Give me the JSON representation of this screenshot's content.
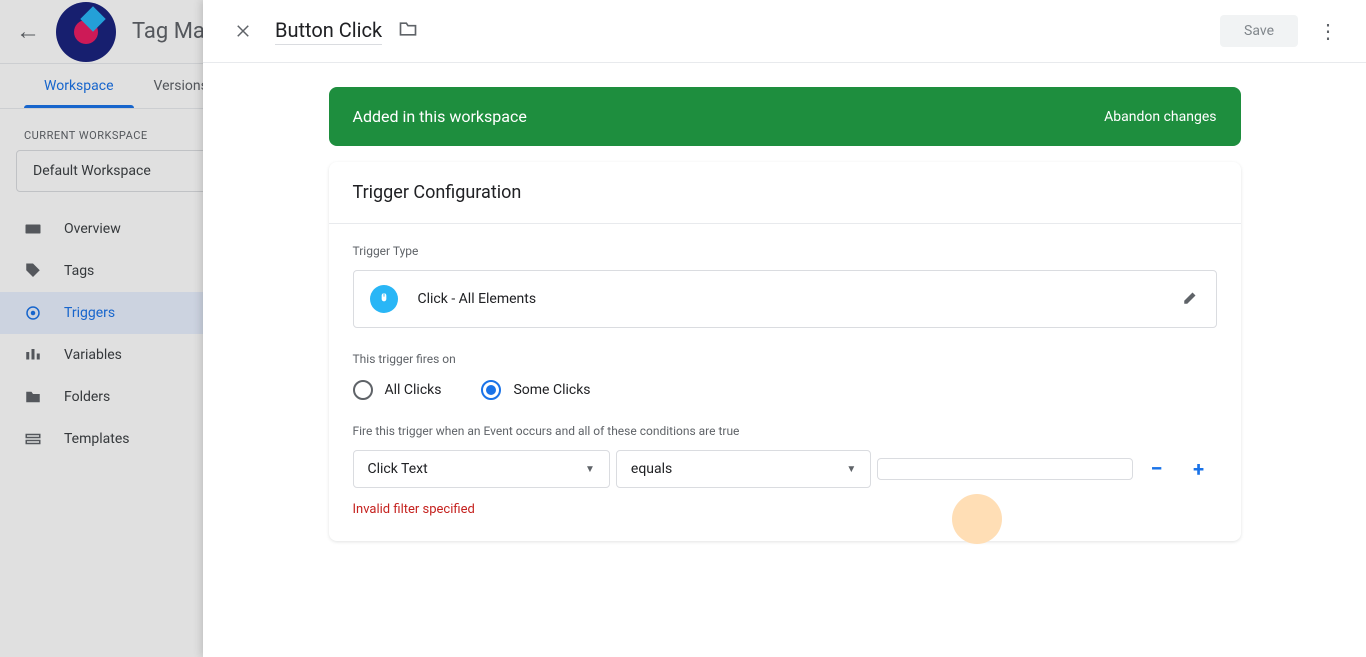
{
  "header": {
    "app_title": "Tag Manage"
  },
  "tabs": {
    "workspace": "Workspace",
    "versions": "Versions"
  },
  "workspace": {
    "label": "CURRENT WORKSPACE",
    "selected": "Default Workspace"
  },
  "nav": {
    "overview": "Overview",
    "tags": "Tags",
    "triggers": "Triggers",
    "variables": "Variables",
    "folders": "Folders",
    "templates": "Templates"
  },
  "overlay": {
    "title": "Button Click",
    "save": "Save"
  },
  "banner": {
    "text": "Added in this workspace",
    "action": "Abandon changes"
  },
  "config": {
    "title": "Trigger Configuration",
    "type_label": "Trigger Type",
    "type_value": "Click - All Elements",
    "fires_label": "This trigger fires on",
    "all_clicks": "All Clicks",
    "some_clicks": "Some Clicks",
    "condition_label": "Fire this trigger when an Event occurs and all of these conditions are true",
    "filter_var": "Click Text",
    "filter_op": "equals",
    "filter_val": "",
    "error": "Invalid filter specified"
  }
}
